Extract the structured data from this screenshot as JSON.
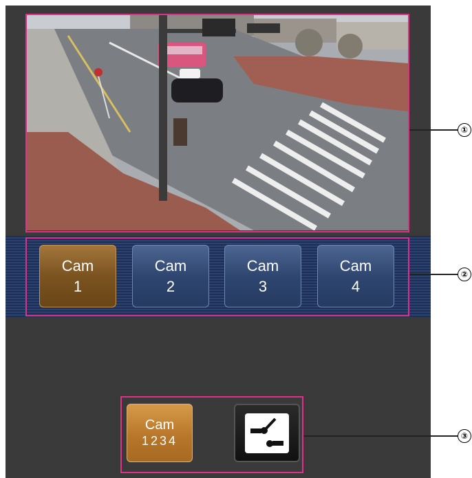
{
  "callouts": [
    "①",
    "②",
    "③"
  ],
  "cameras": [
    {
      "line1": "Cam",
      "line2": "1",
      "active": true
    },
    {
      "line1": "Cam",
      "line2": "2",
      "active": false
    },
    {
      "line1": "Cam",
      "line2": "3",
      "active": false
    },
    {
      "line1": "Cam",
      "line2": "4",
      "active": false
    }
  ],
  "bottom": {
    "multi_line1": "Cam",
    "multi_line2": "1234",
    "control_icon": "camera-control-icon"
  },
  "colors": {
    "highlight": "#e0308a",
    "panel_bg": "#3a3a3a",
    "cam_active": "#7a5320",
    "cam_inactive": "#2e4670"
  }
}
